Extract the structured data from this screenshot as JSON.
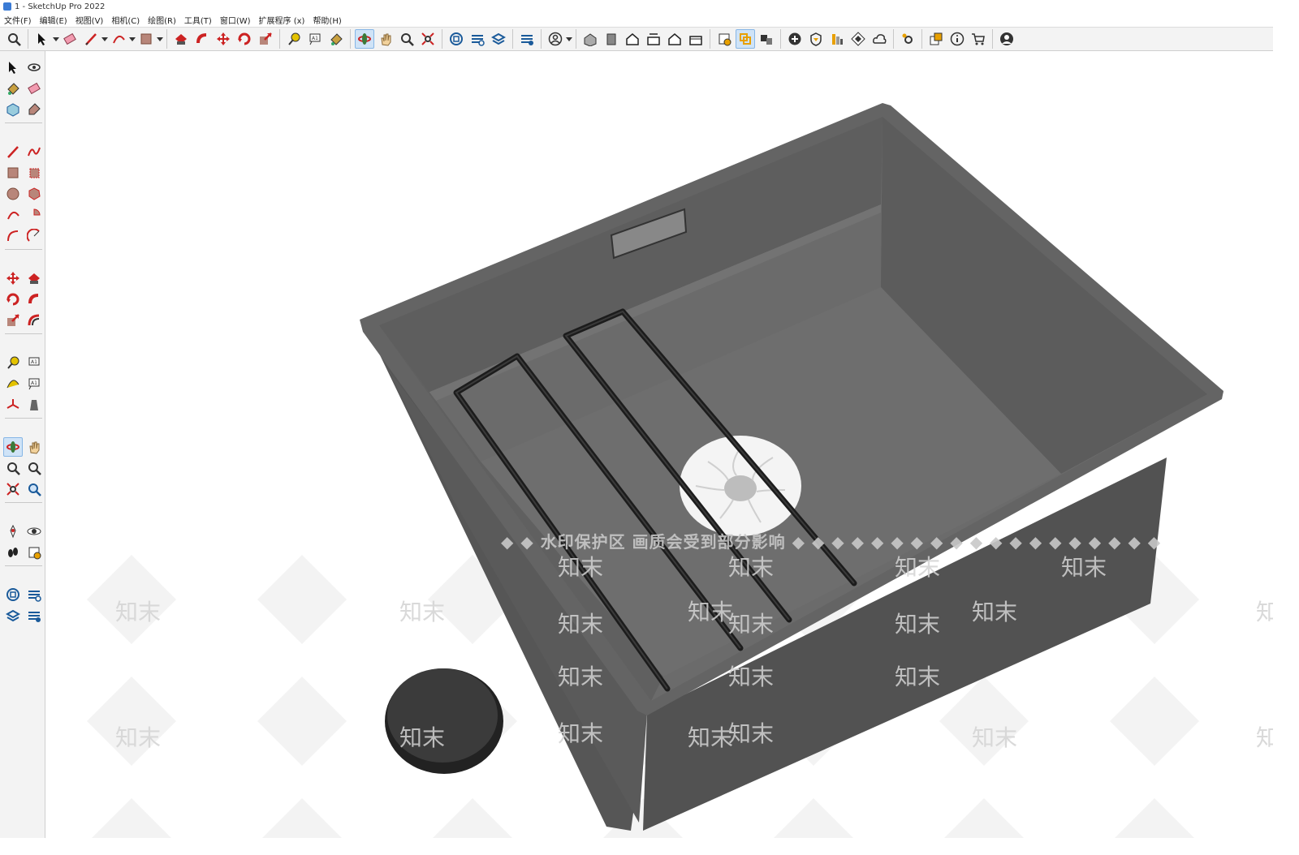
{
  "window": {
    "title": "1 - SketchUp Pro 2022"
  },
  "menu": [
    "文件(F)",
    "编辑(E)",
    "视图(V)",
    "相机(C)",
    "绘图(R)",
    "工具(T)",
    "窗口(W)",
    "扩展程序 (x)",
    "帮助(H)"
  ],
  "toolbar": {
    "tools": [
      {
        "name": "zoom-icon"
      },
      {
        "name": "sep"
      },
      {
        "name": "select-icon",
        "dropdown": true
      },
      {
        "name": "eraser-icon"
      },
      {
        "name": "pencil-line-icon",
        "dropdown": true
      },
      {
        "name": "arc-icon",
        "dropdown": true
      },
      {
        "name": "rectangle-icon",
        "dropdown": true
      },
      {
        "name": "sep"
      },
      {
        "name": "push-pull-icon"
      },
      {
        "name": "follow-me-icon"
      },
      {
        "name": "move-icon"
      },
      {
        "name": "rotate-icon"
      },
      {
        "name": "scale-icon"
      },
      {
        "name": "sep"
      },
      {
        "name": "tape-measure-icon"
      },
      {
        "name": "text-icon"
      },
      {
        "name": "paint-bucket-icon"
      },
      {
        "name": "sep"
      },
      {
        "name": "orbit-icon",
        "active": true
      },
      {
        "name": "pan-icon"
      },
      {
        "name": "zoom-window-icon"
      },
      {
        "name": "zoom-extents-icon"
      },
      {
        "name": "sep"
      },
      {
        "name": "3d-warehouse-icon"
      },
      {
        "name": "extension-warehouse-icon"
      },
      {
        "name": "layout-icon"
      },
      {
        "name": "sep"
      },
      {
        "name": "extension-manager-icon"
      },
      {
        "name": "sep"
      },
      {
        "name": "user-icon",
        "dropdown": true
      },
      {
        "name": "sep"
      },
      {
        "name": "iso-view-icon"
      },
      {
        "name": "top-view-icon"
      },
      {
        "name": "front-view-icon"
      },
      {
        "name": "right-view-icon"
      },
      {
        "name": "back-view-icon"
      },
      {
        "name": "left-view-icon"
      },
      {
        "name": "sep"
      },
      {
        "name": "section-plane-icon"
      },
      {
        "name": "display-section-icon",
        "active": true
      },
      {
        "name": "section-cuts-icon"
      },
      {
        "name": "sep"
      },
      {
        "name": "add-icon"
      },
      {
        "name": "shield-icon"
      },
      {
        "name": "style-icon"
      },
      {
        "name": "checker-icon"
      },
      {
        "name": "cloud-icon"
      },
      {
        "name": "sep"
      },
      {
        "name": "settings-icon"
      },
      {
        "name": "sep"
      },
      {
        "name": "window-icon"
      },
      {
        "name": "info-icon"
      },
      {
        "name": "cart-icon"
      },
      {
        "name": "sep"
      },
      {
        "name": "account-icon"
      }
    ]
  },
  "left_toolbar": {
    "tools": [
      "select-icon",
      "orbit-rotate-icon",
      "paint-bucket-icon",
      "eraser-icon",
      "component-icon",
      "tag-icon",
      "sep",
      "line-icon",
      "freehand-icon",
      "rectangle-icon",
      "rotated-rectangle-icon",
      "circle-icon",
      "polygon-icon",
      "arc-icon",
      "pie-icon",
      "two-point-arc-icon",
      "three-point-arc-icon",
      "sep",
      "move-icon",
      "push-pull-icon",
      "rotate-icon",
      "follow-me-icon",
      "scale-icon",
      "offset-icon",
      "sep",
      "tape-measure-icon",
      "dimension-icon",
      "protractor-icon",
      "text-icon",
      "axes-icon",
      "3d-text-icon",
      "sep",
      "orbit-icon",
      "pan-icon",
      "zoom-icon",
      "zoom-window-icon",
      "zoom-extents-icon",
      "previous-view-icon",
      "sep",
      "position-camera-icon",
      "look-around-icon",
      "walk-icon",
      "section-plane-icon",
      "sep",
      "3d-warehouse-icon",
      "extension-warehouse-icon",
      "layout-icon",
      "extension-manager-icon"
    ]
  },
  "watermark": {
    "banner": "◆ ◆ 水印保护区   画质会受到部分影响 ◆ ◆ ◆ ◆ ◆ ◆ ◆ ◆ ◆ ◆ ◆ ◆ ◆ ◆ ◆ ◆ ◆ ◆ ◆",
    "stamp": "知末"
  },
  "colors": {
    "sink_outer": "#555555",
    "sink_rim": "#626262",
    "sink_inner": "#6a6a6a",
    "accent": "#cc2222"
  }
}
